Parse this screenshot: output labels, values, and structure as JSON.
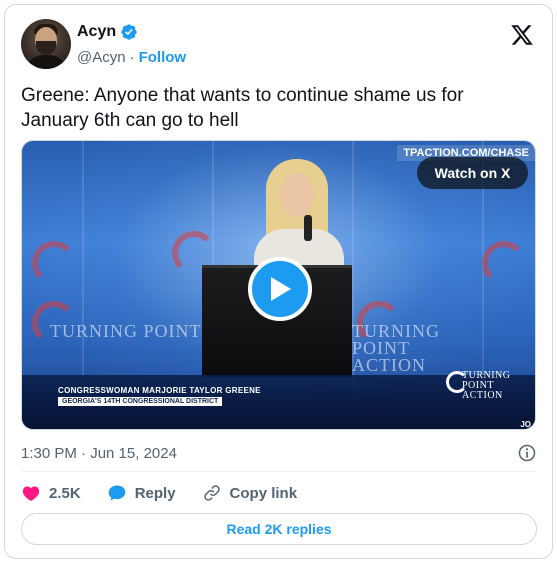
{
  "author": {
    "display_name": "Acyn",
    "handle": "@Acyn",
    "separator": "·",
    "follow_label": "Follow",
    "verified": true
  },
  "tweet": {
    "text": "Greene: Anyone that wants to continue shame us for January 6th can go to hell",
    "timestamp": "1:30 PM · Jun 15, 2024"
  },
  "media": {
    "watch_label": "Watch on X",
    "url_tag": "TPACTION.COM/CHASE",
    "lower_third_name": "CONGRESSWOMAN MARJORIE TAYLOR GREENE",
    "lower_third_district": "GEORGIA'S 14TH CONGRESSIONAL DISTRICT",
    "backdrop_text": "TURNING POINT ACTION",
    "logo_line1": "TURNING",
    "logo_line2": "POINT ACTION",
    "corner_tag": "JO"
  },
  "actions": {
    "likes": "2.5K",
    "reply_label": "Reply",
    "copy_label": "Copy link",
    "read_replies_label": "Read 2K replies"
  },
  "colors": {
    "accent": "#1d9bf0",
    "like": "#f91880",
    "text": "#0f1419",
    "muted": "#536471",
    "border": "#cfd9de"
  },
  "icons": [
    "verified-badge-icon",
    "x-logo-icon",
    "play-icon",
    "info-icon",
    "heart-icon",
    "reply-bubble-icon",
    "link-icon"
  ]
}
